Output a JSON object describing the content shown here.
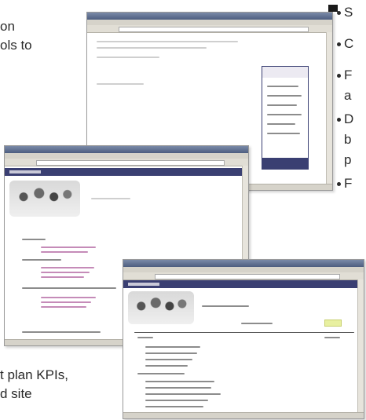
{
  "text": {
    "frag_top_1": "on",
    "frag_top_2": "ols to",
    "frag_bottom_1": "t plan KPIs,",
    "frag_bottom_2": "d site",
    "bullets": [
      "S",
      "C",
      "F",
      "a",
      "D",
      "b",
      "p",
      "F"
    ]
  },
  "windows": {
    "back": {
      "name": "browser-window-back"
    },
    "middle": {
      "name": "browser-window-middle"
    },
    "front": {
      "name": "browser-window-front"
    }
  },
  "colors": {
    "title_bar": "#4e5e80",
    "banner": "#3a3f72",
    "link_pink": "#c58bb8",
    "highlight": "#e8f0a0"
  }
}
